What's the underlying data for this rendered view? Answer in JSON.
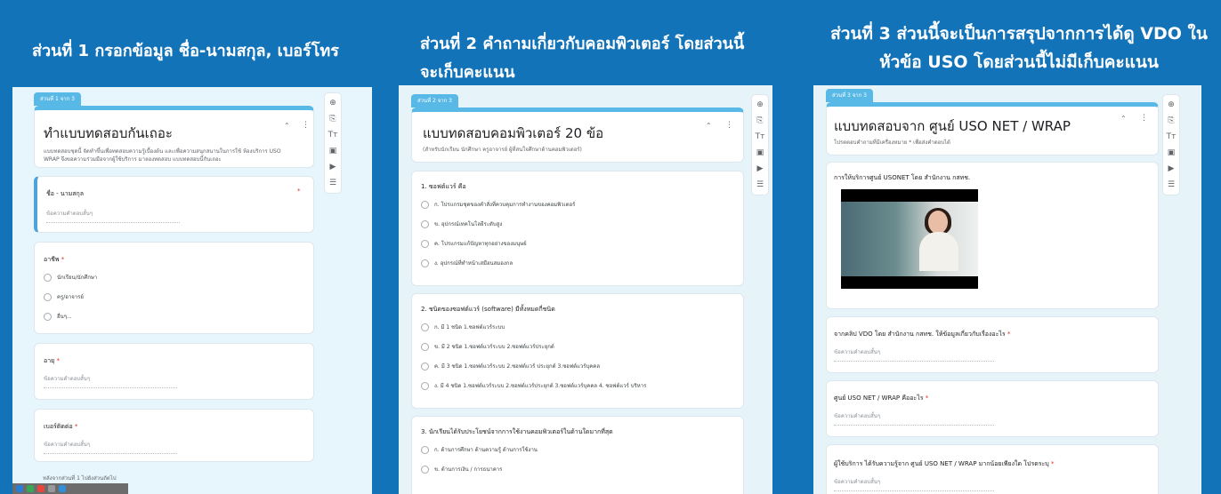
{
  "panels": [
    {
      "heading": "ส่วนที่ 1 กรอกข้อมูล ชื่อ-นามสกุล, เบอร์โทร",
      "section_tag": "ส่วนที่ 1 จาก 3",
      "form_title": "ทำแบบทดสอบกันเถอะ",
      "form_desc": "แบบทดสอบชุดนี้ จัดทำขึ้นเพื่อทดสอบความรู้เบื้องต้น และเพื่อความสนุกสนานในการใช้ ห้องบริการ USO WRAP จึงขอความร่วมมือจากผู้ใช้บริการ มาลองทดสอบ แบบทดสอบนี้กันเถอะ",
      "questions": [
        {
          "label": "ชื่อ - นามสกุล",
          "required": "*",
          "answer_hint": "ข้อความคำตอบสั้นๆ"
        },
        {
          "label": "อาชีพ",
          "required": "*",
          "options": [
            "นักเรียน/นักศึกษา",
            "ครู/อาจารย์",
            "อื่นๆ..."
          ]
        },
        {
          "label": "อายุ",
          "required": "*",
          "answer_hint": "ข้อความคำตอบสั้นๆ"
        },
        {
          "label": "เบอร์ติดต่อ",
          "required": "*",
          "answer_hint": "ข้อความคำตอบสั้นๆ"
        }
      ],
      "footer_text": "หลังจากส่วนที่ 1   ไปยังส่วนถัดไป"
    },
    {
      "heading": "ส่วนที่ 2 คำถามเกี่ยวกับคอมพิวเตอร์ โดยส่วนนี้จะเก็บคะแนน",
      "section_tag": "ส่วนที่ 2 จาก 3",
      "form_title": "แบบทดสอบคอมพิวเตอร์ 20 ข้อ",
      "form_desc": "(สำหรับนักเรียน นักศึกษา ครูอาจารย์ ผู้ที่สนใจศึกษาด้านคอมพิวเตอร์)",
      "questions": [
        {
          "label": "1. ซอฟต์แวร์ คือ",
          "options": [
            "ก. โปรแกรมชุดของคำสั่งที่ควบคุมการทำงานของคอมพิวเตอร์",
            "ข. อุปกรณ์เทคโนโลยีระดับสูง",
            "ค. โปรแกรมแก้ปัญหาทุกอย่างของมนุษย์",
            "ง. อุปกรณ์ที่ทำหน้าเสมือนสมองกล"
          ]
        },
        {
          "label": "2. ชนิดของซอฟต์แวร์ (software) มีทั้งหมดกี่ชนิด",
          "options": [
            "ก. มี 1 ชนิด 1.ซอฟต์แวร์ระบบ",
            "ข. มี 2 ชนิด 1.ซอฟต์แวร์ระบบ 2.ซอฟต์แวร์ประยุกต์",
            "ค. มี 3 ชนิด 1.ซอฟต์แวร์ระบบ 2.ซอฟต์แวร์ ประยุกต์ 3.ซอฟต์แวร์บุคคล",
            "ง. มี 4 ชนิด 1.ซอฟต์แวร์ระบบ 2.ซอฟต์แวร์ประยุกต์ 3.ซอฟต์แวร์บุคคล 4. ซอฟต์แวร์ บริหาร"
          ]
        },
        {
          "label": "3. นักเรียนได้รับประโยชน์จากการใช้งานคอมพิวเตอร์ในด้านใดมากที่สุด",
          "options": [
            "ก. ด้านการศึกษา ด้านความรู้ ด้านการใช้งาน",
            "ข. ด้านการเงิน / การธนาคาร"
          ]
        }
      ]
    },
    {
      "heading": "ส่วนที่ 3 ส่วนนี้จะเป็นการสรุปจากการได้ดู VDO ในหัวข้อ USO โดยส่วนนี้ไม่มีเก็บคะแนน",
      "section_tag": "ส่วนที่ 3 จาก 3",
      "form_title": "แบบทดสอบจาก ศูนย์ USO NET / WRAP",
      "form_desc": "โปรดตอบคำถามที่มีเครื่องหมาย * เพื่อส่งคำตอบได้",
      "video_title": "การให้บริการศูนย์ USONET โดย สำนักงาน กสทช.",
      "questions": [
        {
          "label": "จากคลิป VDO โดย สำนักงาน กสทช. ให้ข้อมูลเกี่ยวกับเรื่องอะไร",
          "required": "*",
          "answer_hint": "ข้อความคำตอบสั้นๆ"
        },
        {
          "label": "ศูนย์ USO NET / WRAP คืออะไร",
          "required": "*",
          "answer_hint": "ข้อความคำตอบสั้นๆ"
        },
        {
          "label": "ผู้ใช้บริการ ได้รับความรู้จาก ศูนย์ USO NET / WRAP มากน้อยเพียงใด โปรดระบุ",
          "required": "*",
          "answer_hint": "ข้อความคำตอบสั้นๆ"
        }
      ]
    }
  ],
  "toolbar_icons": [
    "add-question-icon",
    "import-questions-icon",
    "add-title-icon",
    "add-image-icon",
    "add-video-icon",
    "add-section-icon"
  ],
  "toolbar_glyphs": [
    "⊕",
    "⎘",
    "Tт",
    "▣",
    "▶",
    "☰"
  ],
  "menu_glyph": "⋮",
  "collapse_glyph": "⌃",
  "colors": {
    "background": "#1273b9",
    "accent": "#58b8e6",
    "required": "#d93025"
  }
}
